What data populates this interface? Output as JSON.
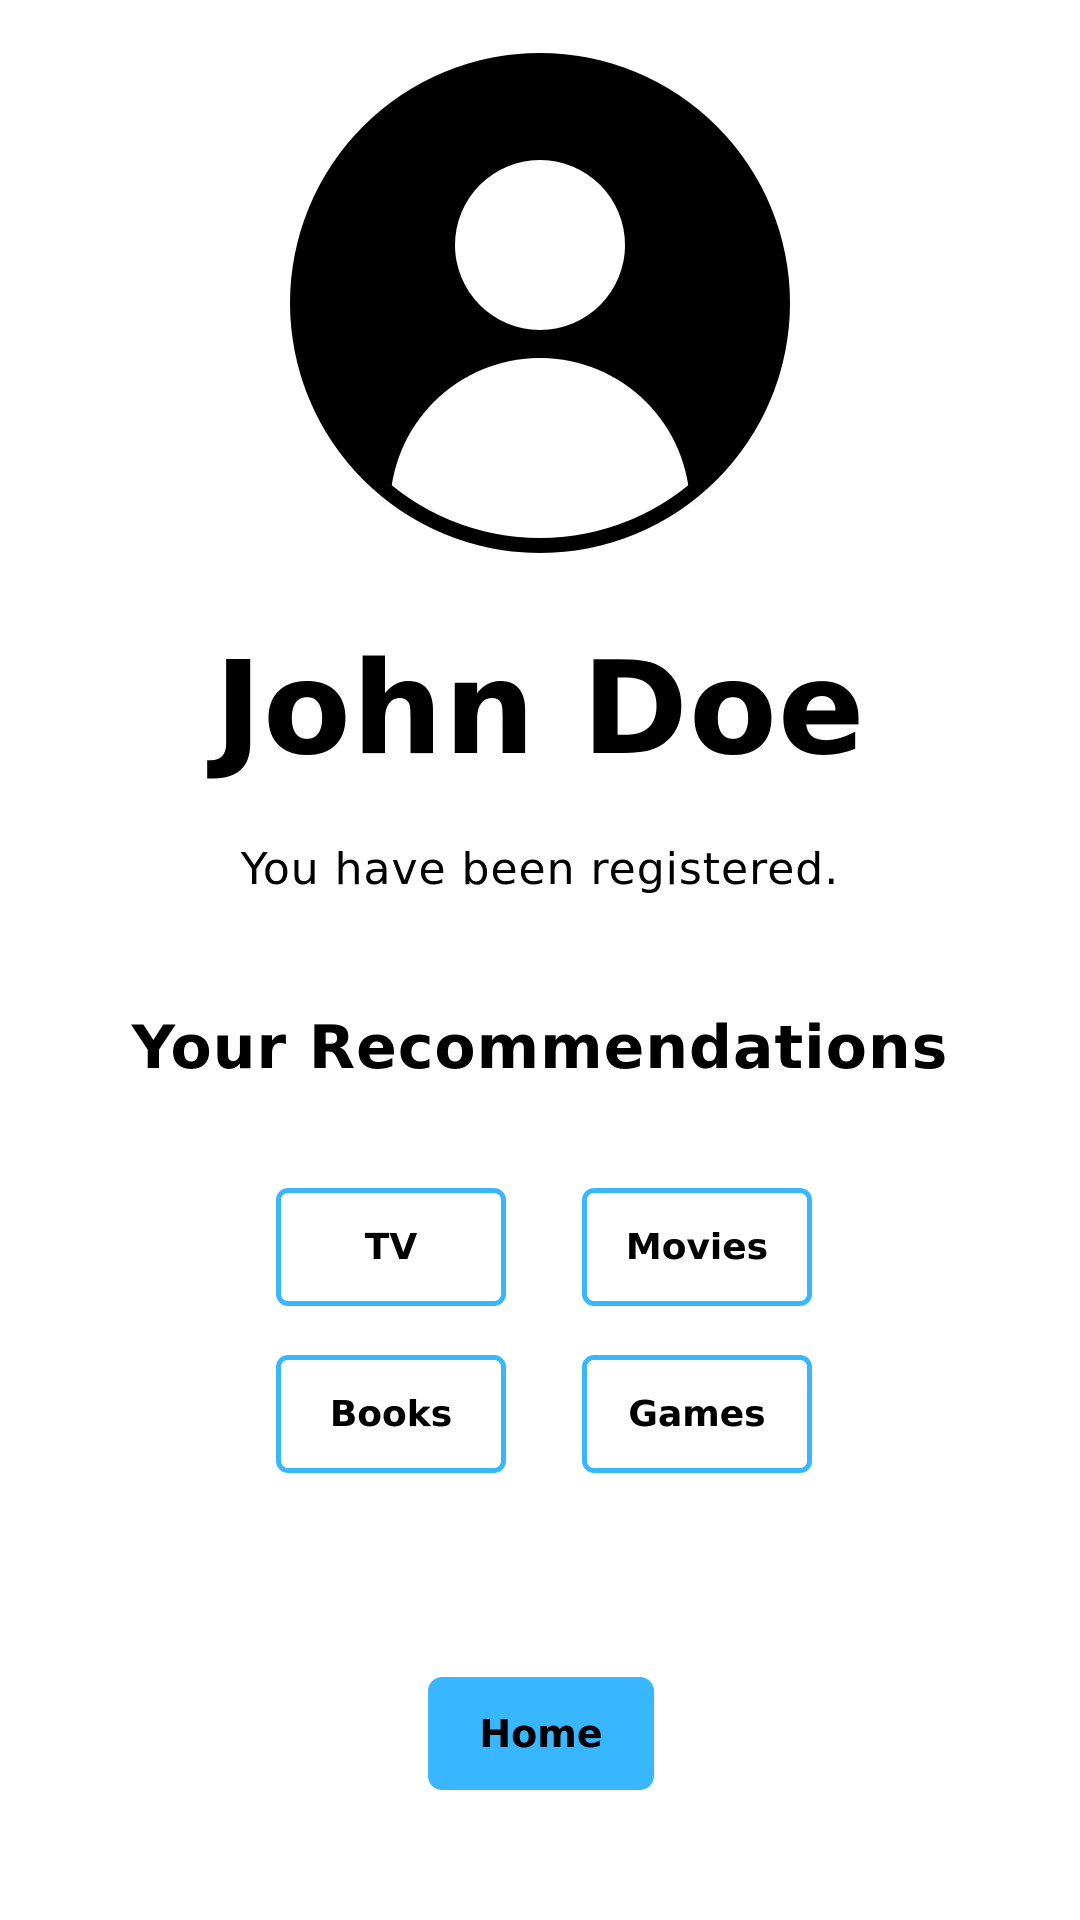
{
  "profile": {
    "avatar_icon": "user-avatar-icon",
    "name": "John Doe",
    "status": "You have been registered."
  },
  "recommendations": {
    "heading": "Your Recommendations",
    "items": [
      {
        "label": "TV"
      },
      {
        "label": "Movies"
      },
      {
        "label": "Books"
      },
      {
        "label": "Games"
      }
    ]
  },
  "navigation": {
    "home_label": "Home"
  },
  "colors": {
    "accent": "#38b6ff",
    "text": "#000000",
    "background": "#ffffff"
  }
}
